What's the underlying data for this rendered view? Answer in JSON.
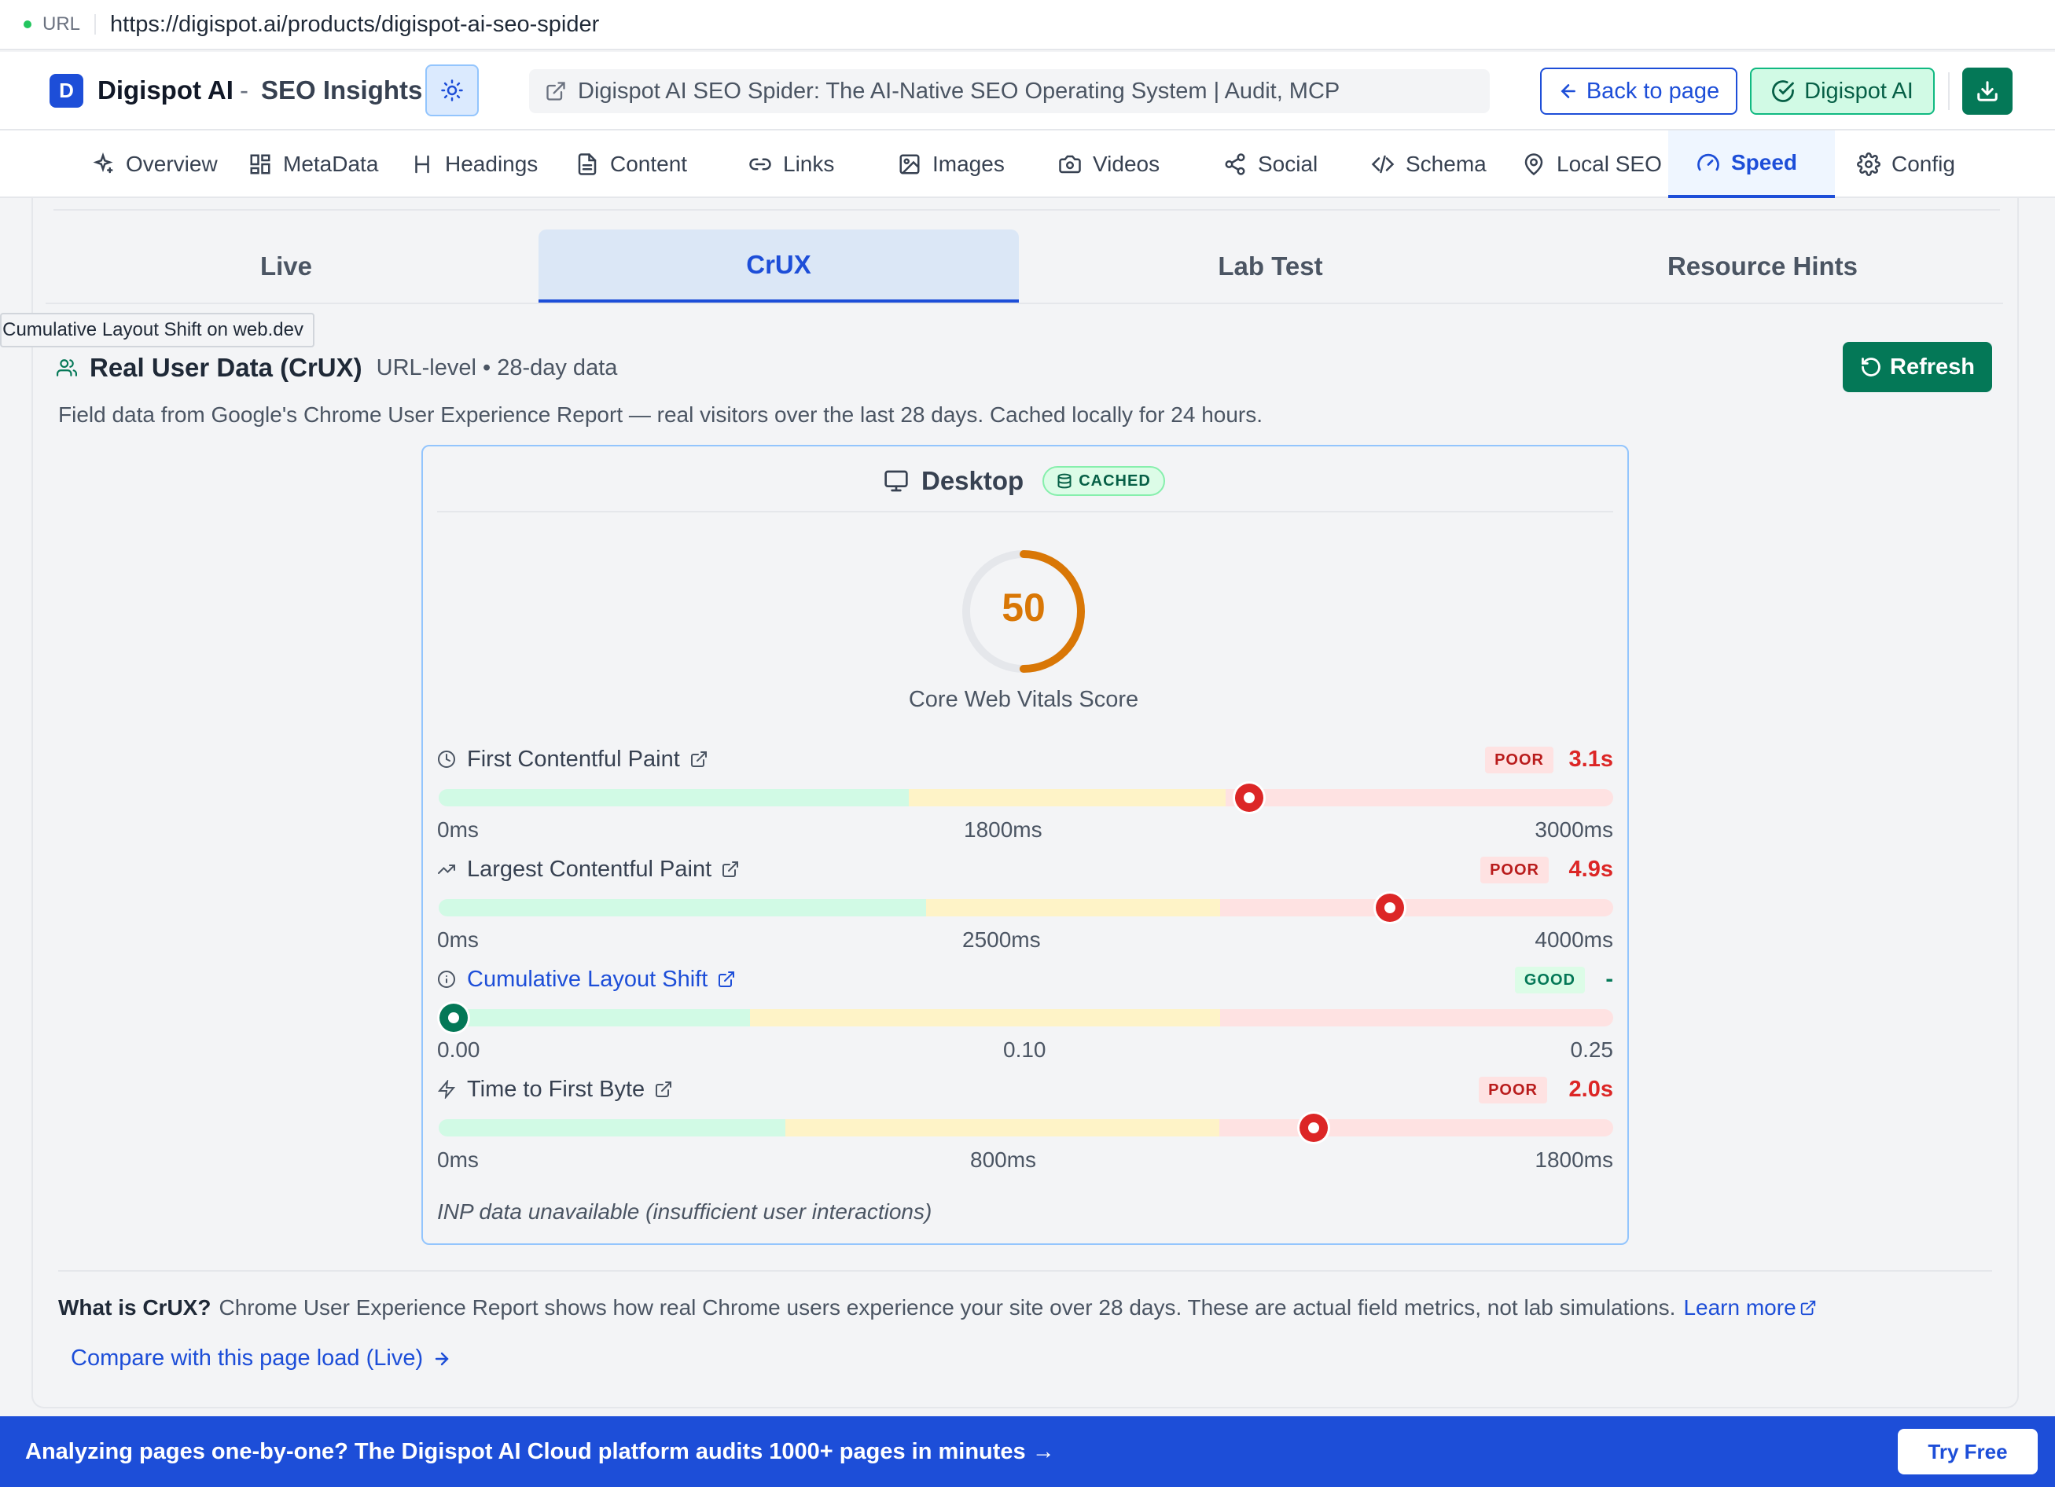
{
  "browser": {
    "url_label": "URL",
    "url": "https://digispot.ai/products/digispot-ai-seo-spider"
  },
  "header": {
    "logo_letter": "D",
    "brand": "Digispot AI",
    "separator": "-",
    "subtitle": "SEO Insights",
    "page_title": "Digispot AI SEO Spider: The AI-Native SEO Operating System | Audit, MCP",
    "back_label": "Back to page",
    "ai_label": "Digispot AI"
  },
  "nav": {
    "items": [
      {
        "label": "Overview",
        "icon": "sparkles-icon"
      },
      {
        "label": "MetaData",
        "icon": "grid-icon"
      },
      {
        "label": "Headings",
        "icon": "heading-icon"
      },
      {
        "label": "Content",
        "icon": "document-icon"
      },
      {
        "label": "Links",
        "icon": "link-icon"
      },
      {
        "label": "Images",
        "icon": "image-icon"
      },
      {
        "label": "Videos",
        "icon": "camera-icon"
      },
      {
        "label": "Social",
        "icon": "share-icon"
      },
      {
        "label": "Schema",
        "icon": "code-icon"
      },
      {
        "label": "Local SEO",
        "icon": "map-pin-icon"
      },
      {
        "label": "Speed",
        "icon": "gauge-icon"
      },
      {
        "label": "Config",
        "icon": "gear-icon"
      }
    ],
    "active": "Speed"
  },
  "subtabs": {
    "items": [
      "Live",
      "CrUX",
      "Lab Test",
      "Resource Hints"
    ],
    "active": "CrUX"
  },
  "tooltip": "Learn about Cumulative Layout Shift on web.dev",
  "crux": {
    "title": "Real User Data (CrUX)",
    "meta": "URL-level • 28-day data",
    "refresh_label": "Refresh",
    "description": "Field data from Google's Chrome User Experience Report — real visitors over the last 28 days. Cached locally for 24 hours."
  },
  "card": {
    "device": "Desktop",
    "cached_label": "CACHED",
    "score": 50,
    "score_label": "Core Web Vitals Score",
    "score_color": "#d97706",
    "metrics": [
      {
        "name": "First Contentful Paint",
        "icon": "clock-icon",
        "status": "POOR",
        "value": "3.1s",
        "ticks": [
          "0ms",
          "1800ms",
          "3000ms"
        ],
        "position": 0.69
      },
      {
        "name": "Largest Contentful Paint",
        "icon": "trend-icon",
        "status": "POOR",
        "value": "4.9s",
        "ticks": [
          "0ms",
          "2500ms",
          "4000ms"
        ],
        "position": 0.81
      },
      {
        "name": "Cumulative Layout Shift",
        "icon": "info-icon",
        "status": "GOOD",
        "value": "-",
        "ticks": [
          "0.00",
          "0.10",
          "0.25"
        ],
        "position": 0.0
      },
      {
        "name": "Time to First Byte",
        "icon": "bolt-icon",
        "status": "POOR",
        "value": "2.0s",
        "ticks": [
          "0ms",
          "800ms",
          "1800ms"
        ],
        "position": 0.745
      }
    ],
    "inp_note": "INP data unavailable (insufficient user interactions)"
  },
  "footer": {
    "what_title": "What is CrUX?",
    "what_text": "Chrome User Experience Report shows how real Chrome users experience your site over 28 days. These are actual field metrics, not lab simulations.",
    "learn_more": "Learn more",
    "compare": "Compare with this page load (Live)"
  },
  "banner": {
    "text": "Analyzing pages one-by-one? The Digispot AI Cloud platform audits 1000+ pages in minutes →",
    "cta": "Try Free"
  },
  "colors": {
    "good": "#d1fae5",
    "needs_improvement": "#fef3c7",
    "poor": "#fee2e2",
    "accent": "#1d4ed8",
    "green": "#047857"
  }
}
